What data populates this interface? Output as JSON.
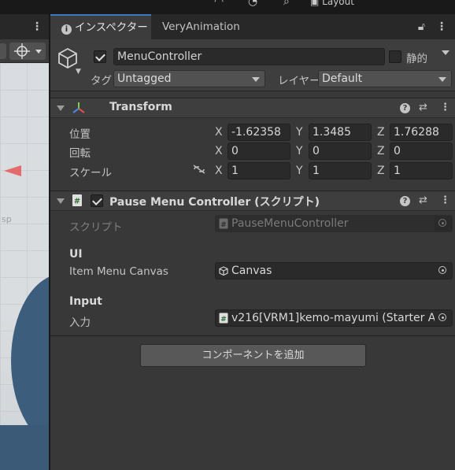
{
  "top_strip": {
    "layout_label": "Layout"
  },
  "scene": {
    "partial_label": "sp"
  },
  "tabs": [
    {
      "label": "インスペクター",
      "active": true
    },
    {
      "label": "VeryAnimation",
      "active": false
    }
  ],
  "gameobject": {
    "name": "MenuController",
    "active": true,
    "static_label": "静的",
    "static": false,
    "tag_label": "タグ",
    "tag_value": "Untagged",
    "layer_label": "レイヤー",
    "layer_value": "Default"
  },
  "transform": {
    "title": "Transform",
    "position_label": "位置",
    "rotation_label": "回転",
    "scale_label": "スケール",
    "axis_x": "X",
    "axis_y": "Y",
    "axis_z": "Z",
    "position": {
      "x": "-1.62358",
      "y": "1.3485",
      "z": "1.76288"
    },
    "rotation": {
      "x": "0",
      "y": "0",
      "z": "0"
    },
    "scale": {
      "x": "1",
      "y": "1",
      "z": "1"
    }
  },
  "script_component": {
    "title": "Pause Menu Controller (スクリプト)",
    "enabled": true,
    "script_label": "スクリプト",
    "script_value": "PauseMenuController",
    "ui_section": "UI",
    "item_menu_canvas_label": "Item Menu Canvas",
    "item_menu_canvas_value": "Canvas",
    "input_section": "Input",
    "input_label": "入力",
    "input_value": "v216[VRM1]kemo-mayumi (Starter A"
  },
  "add_component_label": "コンポーネントを追加",
  "colors": {
    "accent": "#3a79bb",
    "panel": "#383838",
    "header": "#3e3e3e",
    "field": "#2a2a2a"
  }
}
